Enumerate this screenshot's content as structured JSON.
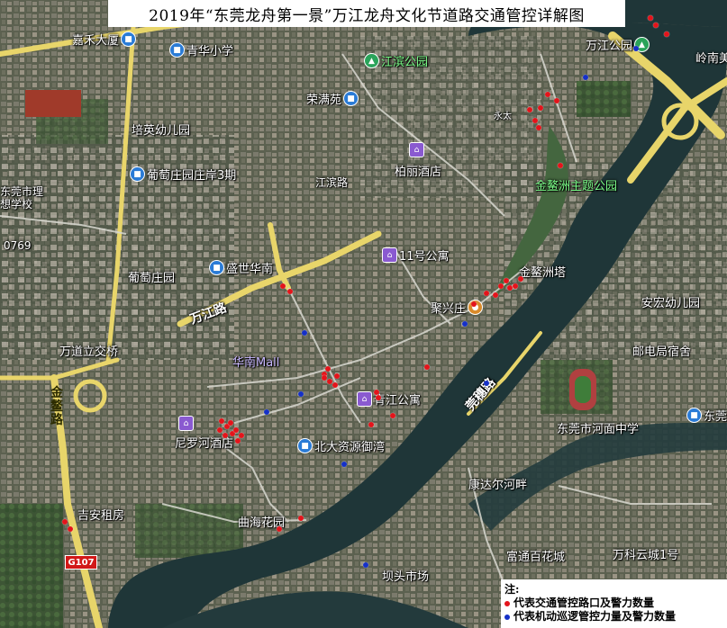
{
  "title": "2019年“东莞龙舟第一景”万江龙舟文化节道路交通管控详解图",
  "labels": [
    {
      "id": "lbl-1",
      "text": "嘉禾大厦",
      "icon": "school"
    },
    {
      "id": "lbl-2",
      "text": "青华小学",
      "icon": "school"
    },
    {
      "id": "lbl-3",
      "text": "江滨公园",
      "icon": "park"
    },
    {
      "id": "lbl-4",
      "text": "万江公园",
      "icon": "park"
    },
    {
      "id": "lbl-5",
      "text": "岭南美",
      "icon": ""
    },
    {
      "id": "lbl-6",
      "text": "荣满苑",
      "icon": "school"
    },
    {
      "id": "lbl-7",
      "text": "培英幼儿园",
      "icon": "school"
    },
    {
      "id": "lbl-8",
      "text": "永太",
      "icon": ""
    },
    {
      "id": "lbl-9",
      "text": "葡萄庄园庄岸3期",
      "icon": "school"
    },
    {
      "id": "lbl-10",
      "text": "柏丽酒店",
      "icon": "hotel"
    },
    {
      "id": "lbl-11",
      "text": "金鳌洲主题公园",
      "icon": "park"
    },
    {
      "id": "lbl-12",
      "text": "江滨路",
      "icon": ""
    },
    {
      "id": "lbl-13",
      "text": "东莞市理想学校",
      "icon": ""
    },
    {
      "id": "lbl-14",
      "text": "11号公寓",
      "icon": "hotel"
    },
    {
      "id": "lbl-15",
      "text": "金鳌洲塔",
      "icon": "shop"
    },
    {
      "id": "lbl-16",
      "text": "葡萄庄园",
      "icon": "school"
    },
    {
      "id": "lbl-17",
      "text": "盛世华南",
      "icon": "school"
    },
    {
      "id": "lbl-18",
      "text": "聚兴庄",
      "icon": "shop"
    },
    {
      "id": "lbl-19",
      "text": "安宏幼儿园",
      "icon": ""
    },
    {
      "id": "lbl-20",
      "text": "万道立交桥",
      "icon": ""
    },
    {
      "id": "lbl-21",
      "text": "华南Mall",
      "icon": ""
    },
    {
      "id": "lbl-22",
      "text": "邮电局宿舍",
      "icon": "school"
    },
    {
      "id": "lbl-23",
      "text": "青江公寓",
      "icon": "hotel"
    },
    {
      "id": "lbl-24",
      "text": "尼罗河酒店",
      "icon": "hotel"
    },
    {
      "id": "lbl-25",
      "text": "东莞市河面中学",
      "icon": "school"
    },
    {
      "id": "lbl-26",
      "text": "东莞",
      "icon": "school"
    },
    {
      "id": "lbl-27",
      "text": "北大资源御湾",
      "icon": "school"
    },
    {
      "id": "lbl-28",
      "text": "康达尔河畔",
      "icon": ""
    },
    {
      "id": "lbl-29",
      "text": "吉安租房",
      "icon": "hotel"
    },
    {
      "id": "lbl-30",
      "text": "曲海花园",
      "icon": "school"
    },
    {
      "id": "lbl-31",
      "text": "富通百花城",
      "icon": "school"
    },
    {
      "id": "lbl-32",
      "text": "万科云城1号",
      "icon": "school"
    },
    {
      "id": "lbl-33",
      "text": "坝头市场",
      "icon": "market"
    }
  ],
  "roads": [
    {
      "id": "road-1",
      "text": "万江路"
    },
    {
      "id": "road-2",
      "text": "金鳌路"
    },
    {
      "id": "road-3",
      "text": "莞穗路"
    },
    {
      "id": "road-4",
      "text": "G107"
    }
  ],
  "area_code": "0769",
  "legend": {
    "note": "注:",
    "red_label": "代表交通管控路口及警力数量",
    "blue_label": "代表机动巡逻管控力量及警力数量",
    "red_color": "#e4141b",
    "blue_color": "#1530c8"
  },
  "markers": {
    "red_count": 44,
    "blue_count": 9
  }
}
